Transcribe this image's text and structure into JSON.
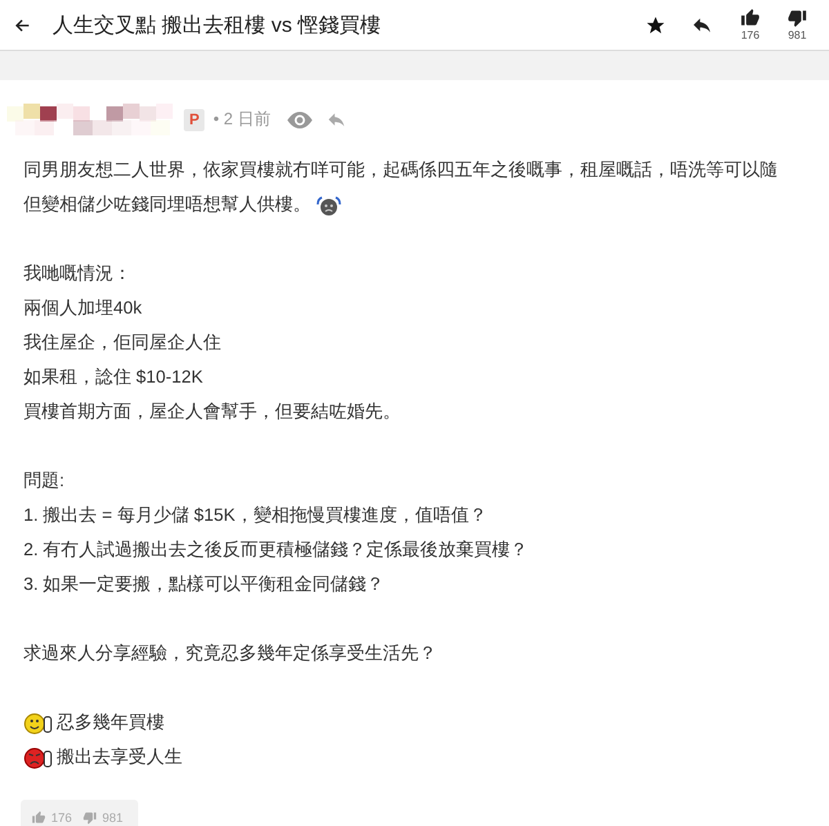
{
  "header": {
    "title": "人生交叉點 搬出去租樓 vs 慳錢買樓",
    "likes": "176",
    "dislikes": "981"
  },
  "post": {
    "badge": "P",
    "time": "• 2 日前",
    "paragraphs": [
      {
        "lines": [
          {
            "kind": "plain",
            "text": "同男朋友想二人世界，依家買樓就冇咩可能，起碼係四五年之後嘅事，租屋嘅話，唔洗等可以隨"
          },
          {
            "kind": "crying",
            "text": "但變相儲少咗錢同埋唔想幫人供樓。"
          }
        ]
      },
      {
        "lines": [
          {
            "kind": "plain",
            "text": "我哋嘅情況："
          },
          {
            "kind": "plain",
            "text": "兩個人加埋40k"
          },
          {
            "kind": "plain",
            "text": "我住屋企，佢同屋企人住"
          },
          {
            "kind": "plain",
            "text": "如果租，諗住 $10-12K"
          },
          {
            "kind": "plain",
            "text": "買樓首期方面，屋企人會幫手，但要結咗婚先。"
          }
        ]
      },
      {
        "lines": [
          {
            "kind": "plain",
            "text": "問題:"
          },
          {
            "kind": "plain",
            "text": "1. 搬出去 = 每月少儲 $15K，變相拖慢買樓進度，值唔值？"
          },
          {
            "kind": "plain",
            "text": "2. 有冇人試過搬出去之後反而更積極儲錢？定係最後放棄買樓？"
          },
          {
            "kind": "plain",
            "text": "3. 如果一定要搬，點樣可以平衡租金同儲錢？"
          }
        ]
      },
      {
        "lines": [
          {
            "kind": "plain",
            "text": "求過來人分享經驗，究竟忍多幾年定係享受生活先？"
          }
        ]
      },
      {
        "lines": [
          {
            "kind": "smiley",
            "text": "忍多幾年買樓"
          },
          {
            "kind": "angry",
            "text": "搬出去享受人生"
          }
        ]
      }
    ],
    "likes": "176",
    "dislikes": "981"
  }
}
